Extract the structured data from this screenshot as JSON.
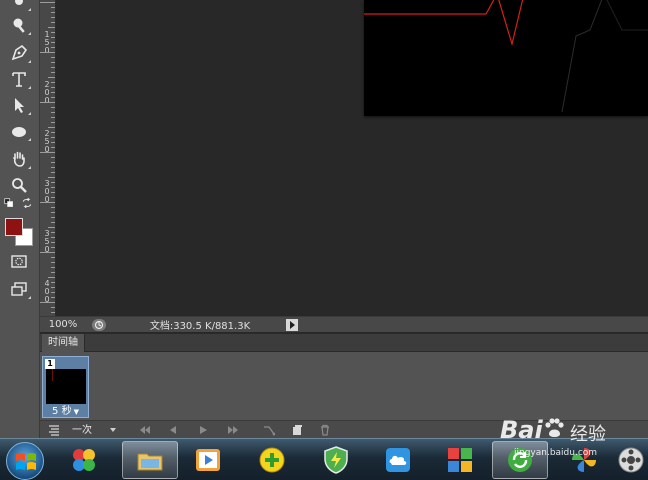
{
  "statusbar": {
    "zoom": "100%",
    "doc_info": "文档:330.5 K/881.3K"
  },
  "ruler": {
    "vertical_labels": [
      "1\n5\n0",
      "2\n0\n0",
      "2\n5\n0",
      "3\n0\n0",
      "3\n5\n0",
      "4\n0\n0"
    ]
  },
  "timeline": {
    "tab_label": "时间轴",
    "frame": {
      "number": "1",
      "delay": "5 秒"
    },
    "loop_option": "一次"
  },
  "colors": {
    "foreground": "#8e1212",
    "background": "#ffffff",
    "canvas_stroke": "#d42020"
  },
  "taskbar": {
    "apps": [
      "start-orb",
      "paint-app-icon",
      "file-explorer-icon",
      "video-player-icon",
      "plus-app-icon",
      "shield-icon",
      "cloud-icon",
      "tiles-icon",
      "refresh-app-icon",
      "pinwheel-icon",
      "media-icon"
    ]
  },
  "watermark": {
    "brand": "Bai",
    "brand2": "经验",
    "url": "jingyan.baidu.com"
  }
}
